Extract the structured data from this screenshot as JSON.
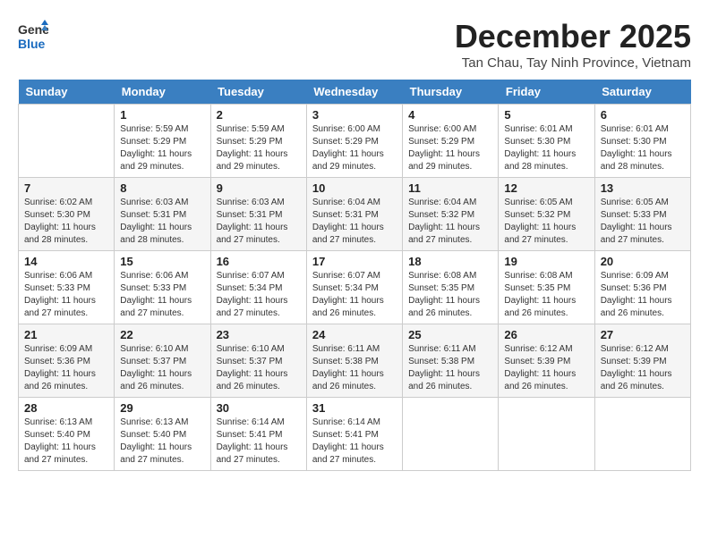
{
  "header": {
    "logo_line1": "General",
    "logo_line2": "Blue",
    "month_title": "December 2025",
    "location": "Tan Chau, Tay Ninh Province, Vietnam"
  },
  "days_of_week": [
    "Sunday",
    "Monday",
    "Tuesday",
    "Wednesday",
    "Thursday",
    "Friday",
    "Saturday"
  ],
  "weeks": [
    [
      {
        "day": "",
        "sunrise": "",
        "sunset": "",
        "daylight": ""
      },
      {
        "day": "1",
        "sunrise": "Sunrise: 5:59 AM",
        "sunset": "Sunset: 5:29 PM",
        "daylight": "Daylight: 11 hours and 29 minutes."
      },
      {
        "day": "2",
        "sunrise": "Sunrise: 5:59 AM",
        "sunset": "Sunset: 5:29 PM",
        "daylight": "Daylight: 11 hours and 29 minutes."
      },
      {
        "day": "3",
        "sunrise": "Sunrise: 6:00 AM",
        "sunset": "Sunset: 5:29 PM",
        "daylight": "Daylight: 11 hours and 29 minutes."
      },
      {
        "day": "4",
        "sunrise": "Sunrise: 6:00 AM",
        "sunset": "Sunset: 5:29 PM",
        "daylight": "Daylight: 11 hours and 29 minutes."
      },
      {
        "day": "5",
        "sunrise": "Sunrise: 6:01 AM",
        "sunset": "Sunset: 5:30 PM",
        "daylight": "Daylight: 11 hours and 28 minutes."
      },
      {
        "day": "6",
        "sunrise": "Sunrise: 6:01 AM",
        "sunset": "Sunset: 5:30 PM",
        "daylight": "Daylight: 11 hours and 28 minutes."
      }
    ],
    [
      {
        "day": "7",
        "sunrise": "Sunrise: 6:02 AM",
        "sunset": "Sunset: 5:30 PM",
        "daylight": "Daylight: 11 hours and 28 minutes."
      },
      {
        "day": "8",
        "sunrise": "Sunrise: 6:03 AM",
        "sunset": "Sunset: 5:31 PM",
        "daylight": "Daylight: 11 hours and 28 minutes."
      },
      {
        "day": "9",
        "sunrise": "Sunrise: 6:03 AM",
        "sunset": "Sunset: 5:31 PM",
        "daylight": "Daylight: 11 hours and 27 minutes."
      },
      {
        "day": "10",
        "sunrise": "Sunrise: 6:04 AM",
        "sunset": "Sunset: 5:31 PM",
        "daylight": "Daylight: 11 hours and 27 minutes."
      },
      {
        "day": "11",
        "sunrise": "Sunrise: 6:04 AM",
        "sunset": "Sunset: 5:32 PM",
        "daylight": "Daylight: 11 hours and 27 minutes."
      },
      {
        "day": "12",
        "sunrise": "Sunrise: 6:05 AM",
        "sunset": "Sunset: 5:32 PM",
        "daylight": "Daylight: 11 hours and 27 minutes."
      },
      {
        "day": "13",
        "sunrise": "Sunrise: 6:05 AM",
        "sunset": "Sunset: 5:33 PM",
        "daylight": "Daylight: 11 hours and 27 minutes."
      }
    ],
    [
      {
        "day": "14",
        "sunrise": "Sunrise: 6:06 AM",
        "sunset": "Sunset: 5:33 PM",
        "daylight": "Daylight: 11 hours and 27 minutes."
      },
      {
        "day": "15",
        "sunrise": "Sunrise: 6:06 AM",
        "sunset": "Sunset: 5:33 PM",
        "daylight": "Daylight: 11 hours and 27 minutes."
      },
      {
        "day": "16",
        "sunrise": "Sunrise: 6:07 AM",
        "sunset": "Sunset: 5:34 PM",
        "daylight": "Daylight: 11 hours and 27 minutes."
      },
      {
        "day": "17",
        "sunrise": "Sunrise: 6:07 AM",
        "sunset": "Sunset: 5:34 PM",
        "daylight": "Daylight: 11 hours and 26 minutes."
      },
      {
        "day": "18",
        "sunrise": "Sunrise: 6:08 AM",
        "sunset": "Sunset: 5:35 PM",
        "daylight": "Daylight: 11 hours and 26 minutes."
      },
      {
        "day": "19",
        "sunrise": "Sunrise: 6:08 AM",
        "sunset": "Sunset: 5:35 PM",
        "daylight": "Daylight: 11 hours and 26 minutes."
      },
      {
        "day": "20",
        "sunrise": "Sunrise: 6:09 AM",
        "sunset": "Sunset: 5:36 PM",
        "daylight": "Daylight: 11 hours and 26 minutes."
      }
    ],
    [
      {
        "day": "21",
        "sunrise": "Sunrise: 6:09 AM",
        "sunset": "Sunset: 5:36 PM",
        "daylight": "Daylight: 11 hours and 26 minutes."
      },
      {
        "day": "22",
        "sunrise": "Sunrise: 6:10 AM",
        "sunset": "Sunset: 5:37 PM",
        "daylight": "Daylight: 11 hours and 26 minutes."
      },
      {
        "day": "23",
        "sunrise": "Sunrise: 6:10 AM",
        "sunset": "Sunset: 5:37 PM",
        "daylight": "Daylight: 11 hours and 26 minutes."
      },
      {
        "day": "24",
        "sunrise": "Sunrise: 6:11 AM",
        "sunset": "Sunset: 5:38 PM",
        "daylight": "Daylight: 11 hours and 26 minutes."
      },
      {
        "day": "25",
        "sunrise": "Sunrise: 6:11 AM",
        "sunset": "Sunset: 5:38 PM",
        "daylight": "Daylight: 11 hours and 26 minutes."
      },
      {
        "day": "26",
        "sunrise": "Sunrise: 6:12 AM",
        "sunset": "Sunset: 5:39 PM",
        "daylight": "Daylight: 11 hours and 26 minutes."
      },
      {
        "day": "27",
        "sunrise": "Sunrise: 6:12 AM",
        "sunset": "Sunset: 5:39 PM",
        "daylight": "Daylight: 11 hours and 26 minutes."
      }
    ],
    [
      {
        "day": "28",
        "sunrise": "Sunrise: 6:13 AM",
        "sunset": "Sunset: 5:40 PM",
        "daylight": "Daylight: 11 hours and 27 minutes."
      },
      {
        "day": "29",
        "sunrise": "Sunrise: 6:13 AM",
        "sunset": "Sunset: 5:40 PM",
        "daylight": "Daylight: 11 hours and 27 minutes."
      },
      {
        "day": "30",
        "sunrise": "Sunrise: 6:14 AM",
        "sunset": "Sunset: 5:41 PM",
        "daylight": "Daylight: 11 hours and 27 minutes."
      },
      {
        "day": "31",
        "sunrise": "Sunrise: 6:14 AM",
        "sunset": "Sunset: 5:41 PM",
        "daylight": "Daylight: 11 hours and 27 minutes."
      },
      {
        "day": "",
        "sunrise": "",
        "sunset": "",
        "daylight": ""
      },
      {
        "day": "",
        "sunrise": "",
        "sunset": "",
        "daylight": ""
      },
      {
        "day": "",
        "sunrise": "",
        "sunset": "",
        "daylight": ""
      }
    ]
  ]
}
